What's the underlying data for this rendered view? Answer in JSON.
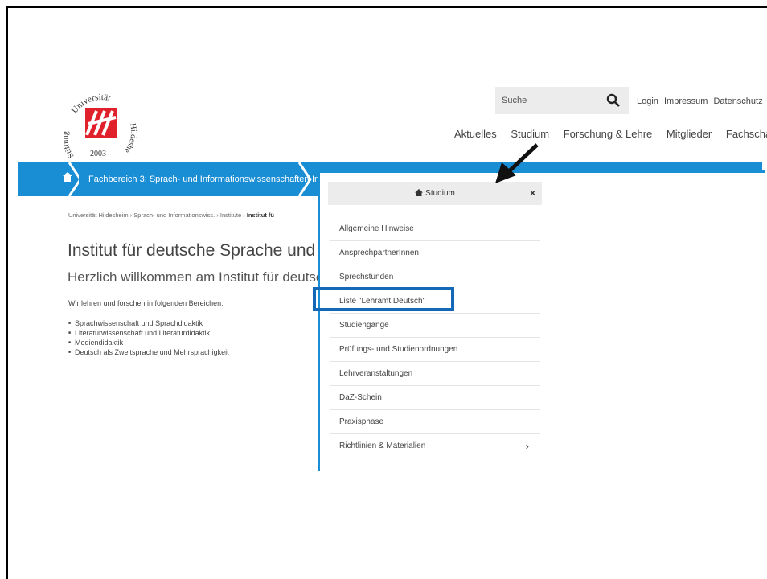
{
  "logo": {
    "ring_top": "Universität",
    "ring_right": "Hildesheim",
    "ring_left": "Stiftung",
    "year": "2003",
    "brand_color": "#e0202a"
  },
  "search": {
    "placeholder": "Suche",
    "icon": "search-icon"
  },
  "top_links": [
    "Login",
    "Impressum",
    "Datenschutz"
  ],
  "main_nav": [
    "Aktuelles",
    "Studium",
    "Forschung & Lehre",
    "Mitglieder",
    "Fachschaft"
  ],
  "bar": {
    "home_icon": "home-icon",
    "label": "Fachbereich 3: Sprach- und Informationswissenschaften",
    "trailing": "In",
    "color": "#1a8ed4"
  },
  "breadcrumb": {
    "items": [
      "Universität Hildesheim",
      "Sprach- und Informationswiss.",
      "Institute"
    ],
    "current": "Institut fü",
    "separator": "›"
  },
  "content": {
    "title": "Institut für deutsche Sprache und L",
    "subtitle": "Herzlich willkommen am Institut für deutsch",
    "intro": "Wir lehren und forschen in folgenden Bereichen:",
    "areas": [
      "Sprachwissenschaft und Sprachdidaktik",
      "Literaturwissenschaft und Literaturdidaktik",
      "Mediendidaktik",
      "Deutsch als Zweitsprache und Mehrsprachigkeit"
    ]
  },
  "dropdown": {
    "title": "Studium",
    "title_icon": "home-icon",
    "close": "×",
    "items": [
      "Allgemeine Hinweise",
      "AnsprechpartnerInnen",
      "Sprechstunden",
      "Liste \"Lehramt Deutsch\"",
      "Studiengänge",
      "Prüfungs- und Studienordnungen",
      "Lehrveranstaltungen",
      "DaZ-Schein",
      "Praxisphase",
      "Richtlinien & Materialien"
    ],
    "submenu_chevron": "›",
    "highlighted_item": "Liste \"Lehramt Deutsch\"",
    "highlight_color": "#1468b8"
  }
}
